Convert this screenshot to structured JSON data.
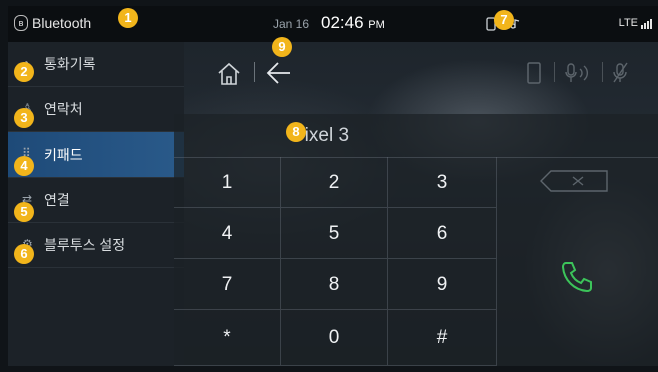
{
  "status": {
    "bluetooth_label": "Bluetooth",
    "date": "Jan 16",
    "time": "02:46",
    "ampm": "PM",
    "network": "LTE"
  },
  "sidebar": {
    "items": [
      {
        "label": "통화기록",
        "icon": "call-history-icon"
      },
      {
        "label": "연락처",
        "icon": "contacts-icon"
      },
      {
        "label": "키패드",
        "icon": "keypad-icon"
      },
      {
        "label": "연결",
        "icon": "connection-icon"
      },
      {
        "label": "블루투스 설정",
        "icon": "settings-icon"
      }
    ],
    "active_index": 2
  },
  "header": {
    "home_icon": "home-icon",
    "back_icon": "back-arrow-icon",
    "right_icons": [
      "phone-icon",
      "voice-icon",
      "mute-icon"
    ]
  },
  "keypad": {
    "device_name": "Pixel 3",
    "keys": [
      "1",
      "2",
      "3",
      "4",
      "5",
      "6",
      "7",
      "8",
      "9",
      "*",
      "0",
      "#"
    ],
    "delete_icon": "backspace-icon",
    "call_icon": "call-icon"
  },
  "badges": [
    "1",
    "2",
    "3",
    "4",
    "5",
    "6",
    "7",
    "8",
    "9"
  ],
  "colors": {
    "badge": "#f2b51b",
    "active_item": "#2a5a8a",
    "call_green": "#3cc45a"
  }
}
